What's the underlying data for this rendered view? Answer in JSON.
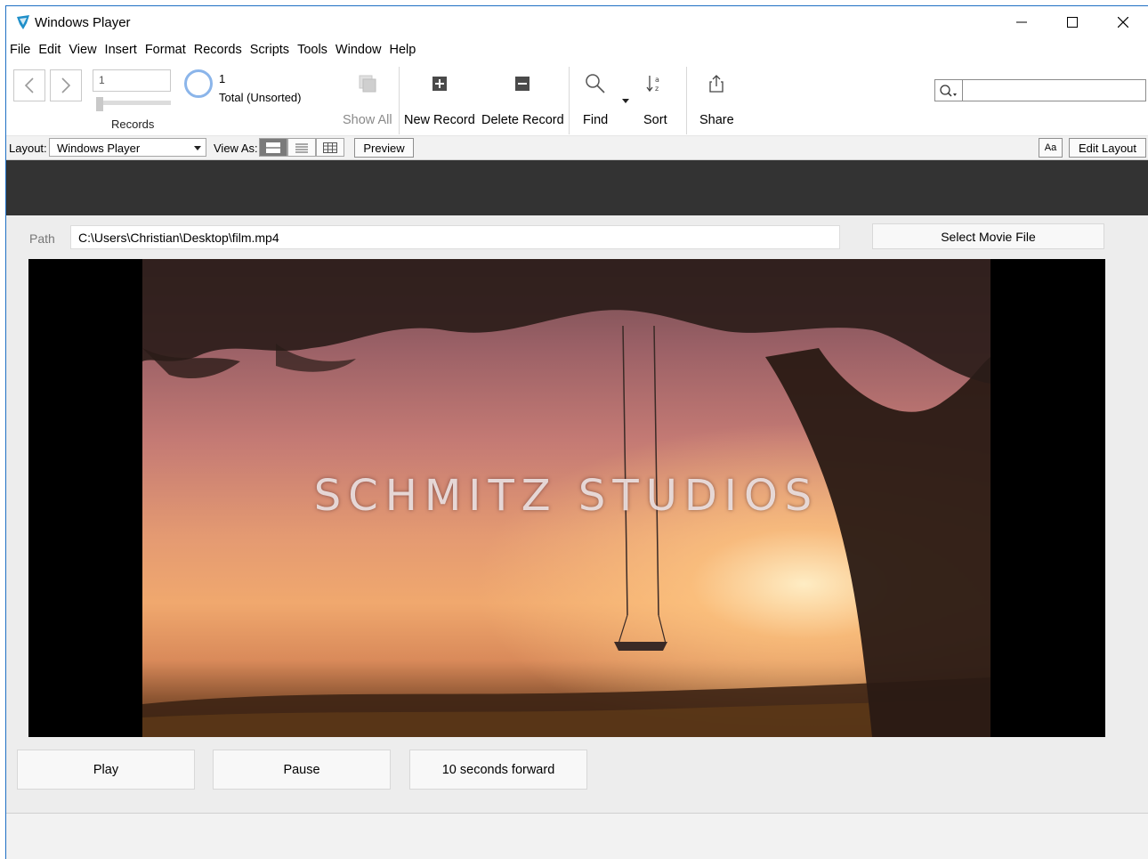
{
  "window": {
    "title": "Windows Player"
  },
  "menu": [
    "File",
    "Edit",
    "View",
    "Insert",
    "Format",
    "Records",
    "Scripts",
    "Tools",
    "Window",
    "Help"
  ],
  "toolbar": {
    "record_number": "1",
    "records_label": "Records",
    "found_count": "1",
    "total_label": "Total (Unsorted)",
    "show_all": "Show All",
    "new_record": "New Record",
    "delete_record": "Delete Record",
    "find": "Find",
    "sort": "Sort",
    "share": "Share"
  },
  "layoutbar": {
    "layout_label": "Layout:",
    "layout_value": "Windows Player",
    "view_as_label": "View As:",
    "preview": "Preview",
    "text_format": "Aa",
    "edit_layout": "Edit Layout"
  },
  "content": {
    "path_label": "Path",
    "path_value": "C:\\Users\\Christian\\Desktop\\film.mp4",
    "select_movie": "Select Movie File",
    "video_overlay_text": "SCHMITZ STUDIOS",
    "play": "Play",
    "pause": "Pause",
    "forward": "10 seconds forward"
  },
  "colors": {
    "header_band": "#333333",
    "body_bg": "#ededed",
    "accent": "#1e6fc4"
  }
}
